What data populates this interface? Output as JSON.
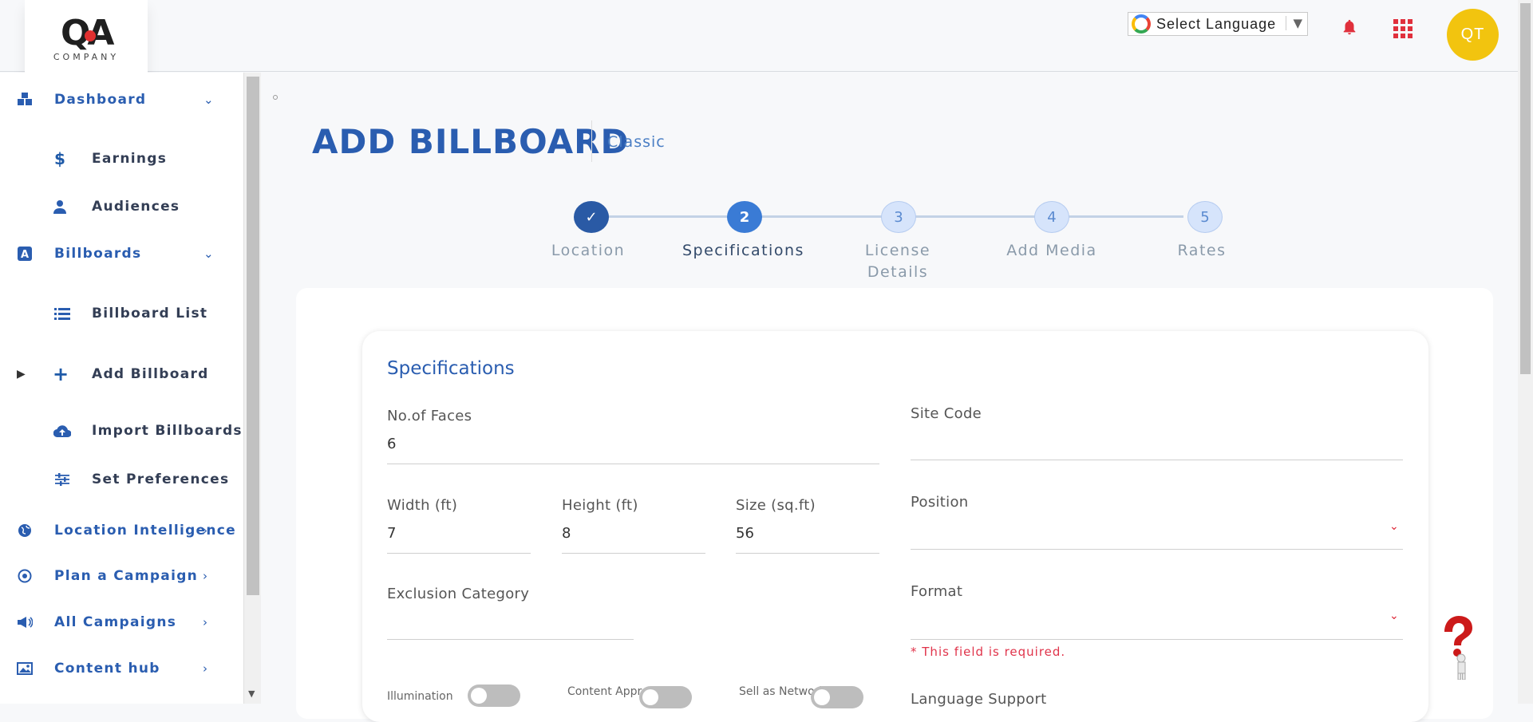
{
  "header": {
    "logo_text": "QA",
    "logo_sub": "COMPANY",
    "language_label": "Select Language",
    "avatar_initials": "QT"
  },
  "sidebar": {
    "items": [
      {
        "label": "Dashboard",
        "icon": "cubes-icon"
      },
      {
        "label": "Earnings",
        "icon": "dollar-icon"
      },
      {
        "label": "Audiences",
        "icon": "user-icon"
      },
      {
        "label": "Billboards",
        "icon": "billboard-a-icon"
      },
      {
        "label": "Billboard List",
        "icon": "list-icon"
      },
      {
        "label": "Add Billboard",
        "icon": "plus-icon"
      },
      {
        "label": "Import Billboards",
        "icon": "cloud-upload-icon"
      },
      {
        "label": "Set Preferences",
        "icon": "sliders-icon"
      },
      {
        "label": "Location Intelligence",
        "icon": "globe-icon"
      },
      {
        "label": "Plan a Campaign",
        "icon": "target-icon"
      },
      {
        "label": "All Campaigns",
        "icon": "megaphone-icon"
      },
      {
        "label": "Content hub",
        "icon": "image-icon"
      }
    ]
  },
  "page": {
    "title": "ADD BILLBOARD",
    "subtitle": "Classic"
  },
  "stepper": {
    "steps": [
      {
        "num": "✓",
        "label": "Location",
        "state": "done"
      },
      {
        "num": "2",
        "label": "Specifications",
        "state": "current"
      },
      {
        "num": "3",
        "label": "License Details",
        "state": "todo"
      },
      {
        "num": "4",
        "label": "Add Media",
        "state": "todo"
      },
      {
        "num": "5",
        "label": "Rates",
        "state": "todo"
      }
    ]
  },
  "form": {
    "section_title": "Specifications",
    "faces_label": "No.of Faces",
    "faces_value": "6",
    "site_code_label": "Site Code",
    "site_code_value": "",
    "width_label": "Width (ft)",
    "width_value": "7",
    "height_label": "Height (ft)",
    "height_value": "8",
    "size_label": "Size (sq.ft)",
    "size_value": "56",
    "position_label": "Position",
    "exclusion_label": "Exclusion Category",
    "format_label": "Format",
    "format_error": "* This field is required.",
    "illumination_label": "Illumination",
    "content_label": "Content Approval",
    "sell_label": "Sell as Network",
    "language_support_label": "Language Support"
  },
  "colors": {
    "primary": "#2a5db0",
    "accent_yellow": "#f2c40f",
    "alert_red": "#e0303c"
  }
}
